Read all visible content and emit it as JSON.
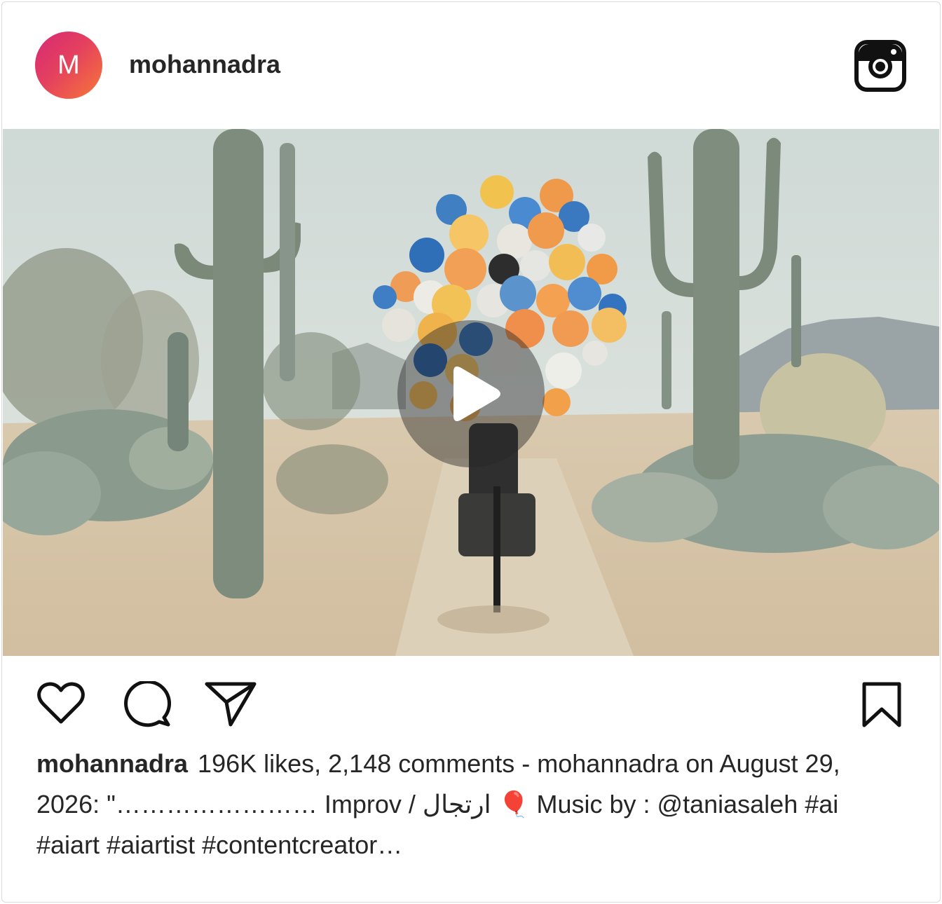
{
  "post": {
    "avatar_letter": "M",
    "username": "mohannadra",
    "caption_user": "mohannadra",
    "caption_text": "196K likes, 2,148 comments - mohannadra on August 29, 2026: \"…………………… Improv / ارتجال 🎈 Music by : @taniasaleh #ai #aiart #aiartist #contentcreator…"
  },
  "icons": {
    "header_logo": "instagram-icon",
    "media_play": "play-icon",
    "like": "heart-icon",
    "comment": "comment-bubble-icon",
    "share": "send-icon",
    "save": "bookmark-icon"
  },
  "colors": {
    "text": "#262626",
    "border": "#dbdbdb",
    "avatar_gradient_start": "#d62976",
    "avatar_gradient_end": "#f77737"
  }
}
